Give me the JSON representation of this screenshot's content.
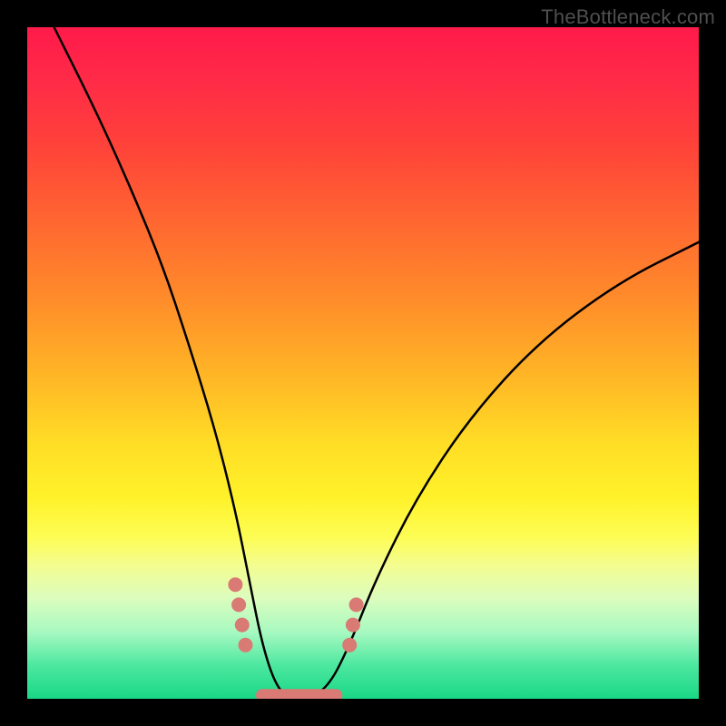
{
  "watermark": "TheBottleneck.com",
  "chart_data": {
    "type": "line",
    "title": "",
    "xlabel": "",
    "ylabel": "",
    "xlim": [
      0,
      100
    ],
    "ylim": [
      0,
      100
    ],
    "background_gradient": {
      "top": "#ff1a4a",
      "mid": "#ffdd26",
      "bottom": "#19d786"
    },
    "series": [
      {
        "name": "bottleneck-curve",
        "color": "#000000",
        "x": [
          4,
          10,
          15,
          20,
          24,
          28,
          31,
          33,
          35,
          37,
          39,
          42,
          45,
          48,
          52,
          58,
          66,
          76,
          88,
          100
        ],
        "values": [
          100,
          88,
          77,
          65,
          53,
          40,
          28,
          18,
          8,
          2,
          0,
          0,
          2,
          8,
          18,
          30,
          42,
          53,
          62,
          68
        ]
      }
    ],
    "markers": {
      "name": "trough-dots",
      "color": "#d97a74",
      "points": [
        {
          "x": 31.0,
          "y": 17
        },
        {
          "x": 31.5,
          "y": 14
        },
        {
          "x": 32.0,
          "y": 11
        },
        {
          "x": 32.5,
          "y": 8
        },
        {
          "x": 48.0,
          "y": 8
        },
        {
          "x": 48.5,
          "y": 11
        },
        {
          "x": 49.0,
          "y": 14
        }
      ]
    },
    "flat_segment": {
      "name": "trough-flat",
      "color": "#d97a74",
      "x_range": [
        35,
        46
      ],
      "y": 0.5
    }
  }
}
